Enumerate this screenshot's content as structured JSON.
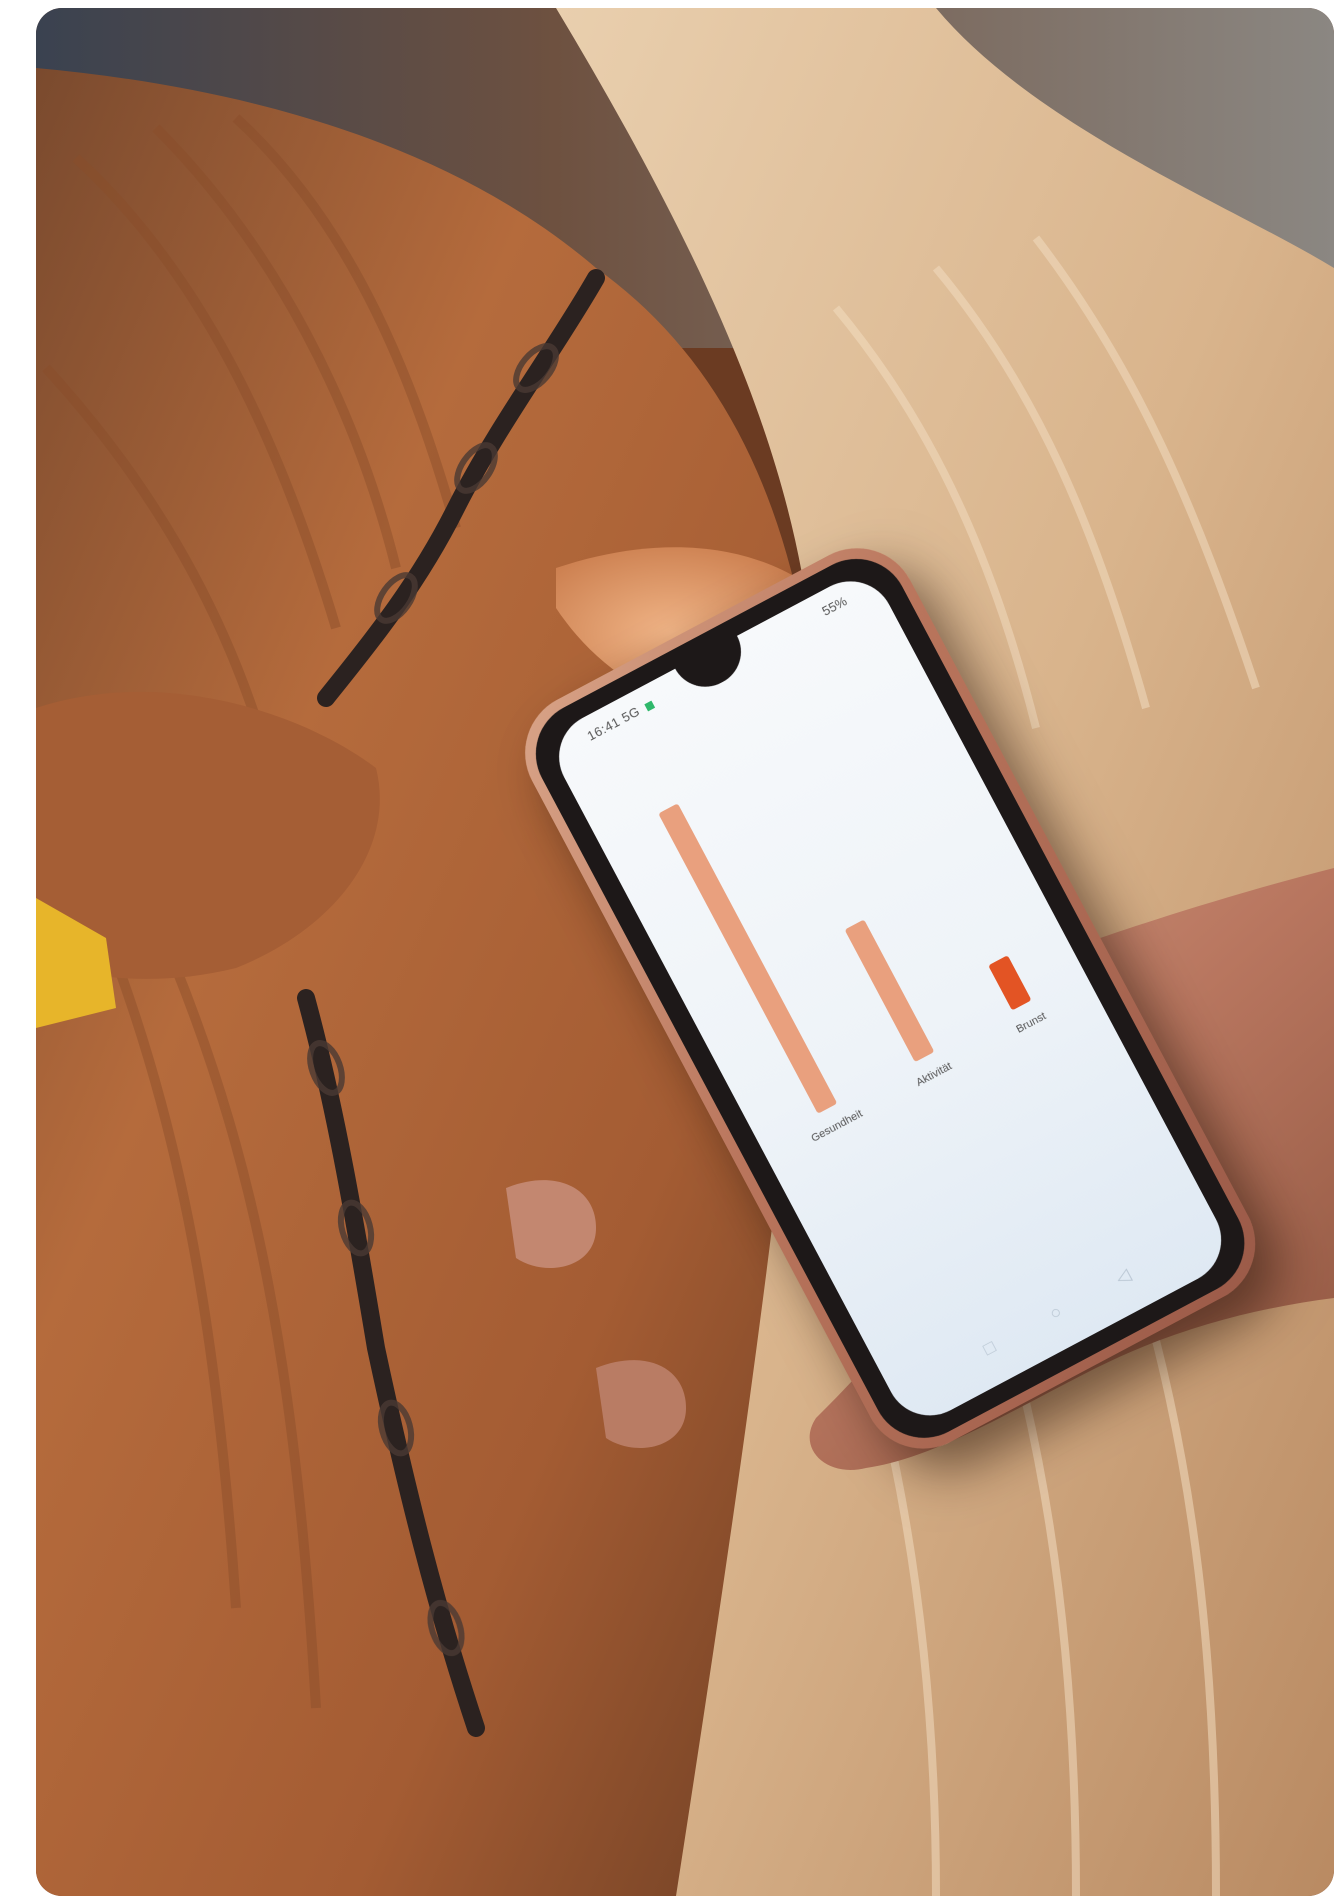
{
  "image": {
    "alt": "",
    "scene": "photo",
    "colors": {
      "cow_fur": "#b46a3a",
      "cow_fur_light": "#e8c9a4",
      "chain": "#2b2220",
      "ear_tag": "#e7b52a",
      "skin": "#c98b72",
      "screen": "#f1f5f9",
      "bar_light": "#e9a07e",
      "bar_accent": "#e35424"
    }
  },
  "phone": {
    "status_time": "16:41",
    "status_signal": "5G",
    "status_right": "55%",
    "chart_data": {
      "type": "bar",
      "categories": [
        "Gesundheit",
        "Aktivität",
        "Brunst"
      ],
      "values": [
        100,
        44,
        15
      ],
      "colors": [
        "#e9a07e",
        "#e9a07e",
        "#e35424"
      ],
      "title": "",
      "xlabel": "",
      "ylabel": ""
    }
  }
}
